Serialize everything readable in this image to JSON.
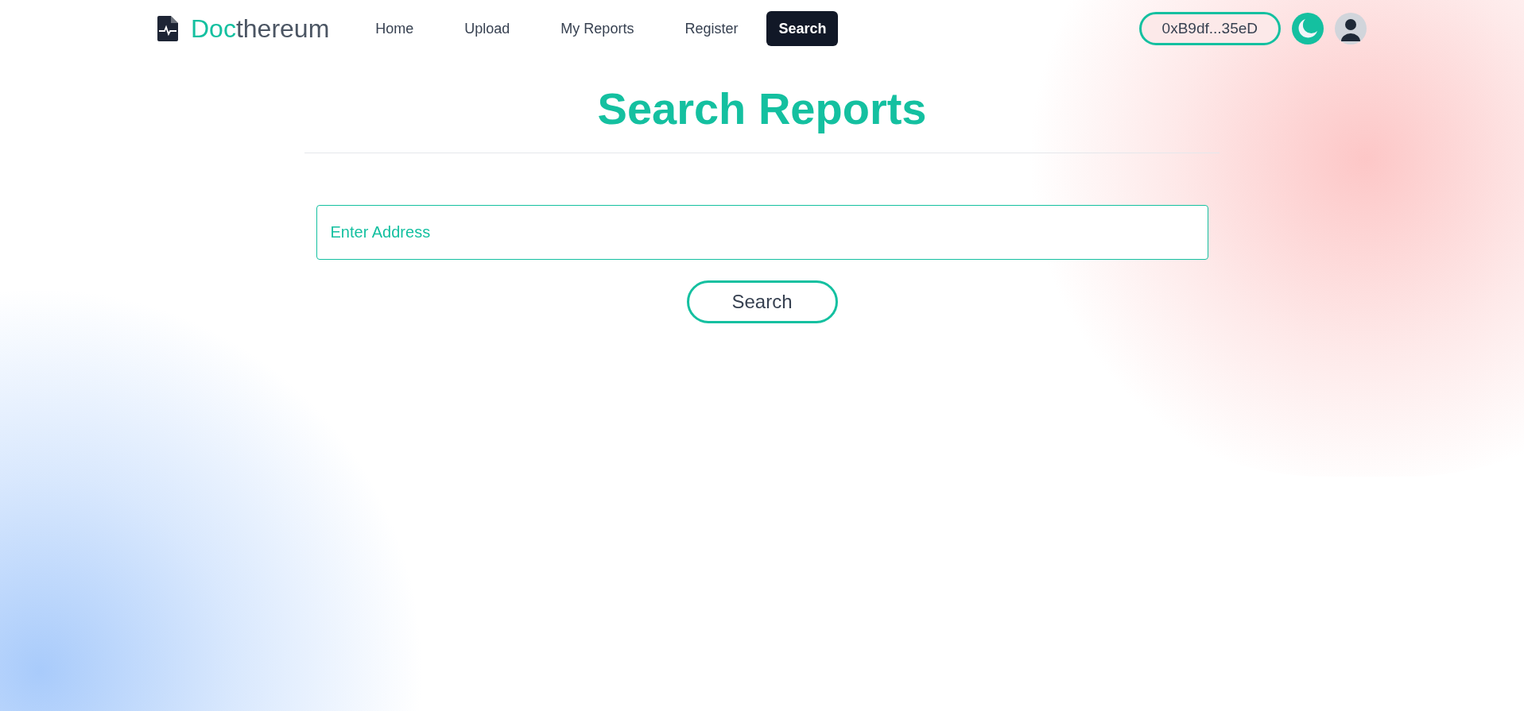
{
  "brand": {
    "accent": "Doc",
    "rest": "thereum"
  },
  "nav": [
    {
      "label": "Home",
      "selected": false
    },
    {
      "label": "Upload",
      "selected": false
    },
    {
      "label": "My Reports",
      "selected": false
    },
    {
      "label": "Register",
      "selected": false
    },
    {
      "label": "Search",
      "selected": true
    }
  ],
  "wallet": {
    "address": "0xB9df...35eD"
  },
  "page": {
    "title": "Search Reports"
  },
  "search": {
    "placeholder": "Enter Address",
    "button": "Search"
  }
}
